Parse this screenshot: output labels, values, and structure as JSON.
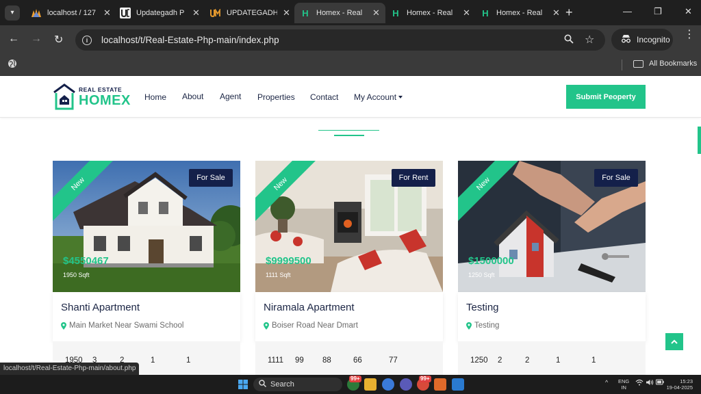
{
  "browser": {
    "tabs": [
      {
        "title": "localhost / 127",
        "favicon": "phpmyadmin-icon",
        "active": false
      },
      {
        "title": "Updategadh P",
        "favicon": "ug-icon",
        "active": false
      },
      {
        "title": "UPDATEGADH",
        "favicon": "um-icon",
        "active": false
      },
      {
        "title": "Homex - Real",
        "favicon": "homex-icon",
        "active": true
      },
      {
        "title": "Homex - Real",
        "favicon": "homex-icon",
        "active": false
      },
      {
        "title": "Homex - Real",
        "favicon": "homex-icon",
        "active": false
      }
    ],
    "favicon_letters": {
      "homex": "H"
    },
    "url": "localhost/t/Real-Estate-Php-main/index.php",
    "incognito_label": "Incognito",
    "all_bookmarks_label": "All Bookmarks",
    "status_url": "localhost/t/Real-Estate-Php-main/about.php"
  },
  "site": {
    "logo_top": "REAL ESTATE",
    "logo_main": "HOMEX",
    "nav": [
      "Home",
      "About",
      "Agent",
      "Properties",
      "Contact",
      "My Account"
    ],
    "submit_label": "Submit Peoperty",
    "accent_color": "#22c48a",
    "navy_color": "#14204a"
  },
  "properties": [
    {
      "ribbon": "New",
      "badge": "For Sale",
      "price": "$4550467",
      "sqft": "1950 Sqft",
      "name": "Shanti Apartment",
      "address": "Main Market Near Swami School",
      "stats": [
        "1950",
        "3",
        "2",
        "1",
        "1"
      ]
    },
    {
      "ribbon": "New",
      "badge": "For Rent",
      "price": "$9999500",
      "sqft": "1111 Sqft",
      "name": "Niramala Apartment",
      "address": "Boiser Road Near Dmart",
      "stats": [
        "1111",
        "99",
        "88",
        "66",
        "77"
      ]
    },
    {
      "ribbon": "New",
      "badge": "For Sale",
      "price": "$1500000",
      "sqft": "1250 Sqft",
      "name": "Testing",
      "address": "Testing",
      "stats": [
        "1250",
        "2",
        "2",
        "1",
        "1"
      ]
    }
  ],
  "taskbar": {
    "search_label": "Search",
    "badges": [
      "99+",
      "99+"
    ],
    "lang": "ENG",
    "region": "IN",
    "time": "15:23",
    "date": "19-04-2025"
  }
}
